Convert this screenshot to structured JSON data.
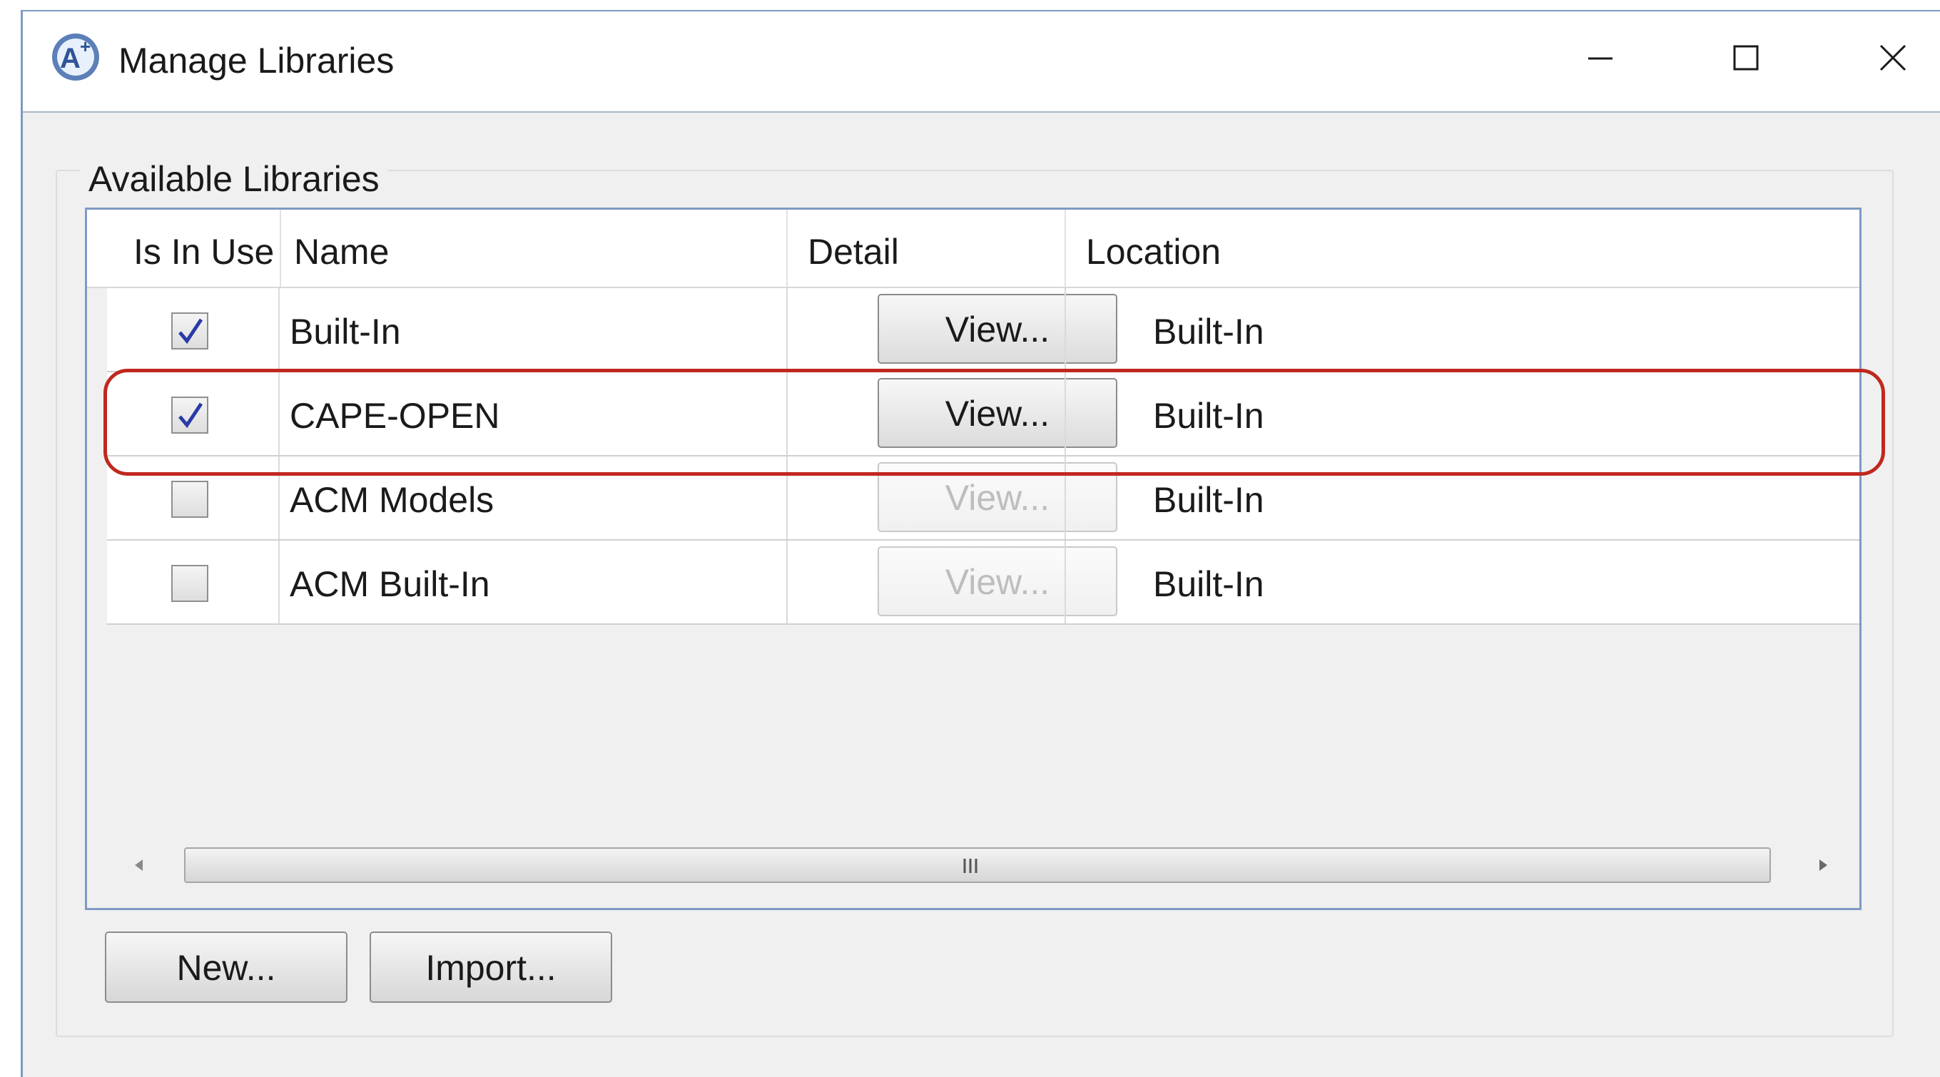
{
  "window": {
    "title": "Manage Libraries",
    "controls": {
      "minimize": "minimize-icon",
      "maximize": "maximize-icon",
      "close": "close-icon"
    }
  },
  "group": {
    "label": "Available Libraries"
  },
  "grid": {
    "columns": [
      "Is In Use",
      "Name",
      "Detail",
      "Location"
    ],
    "rows": [
      {
        "in_use": true,
        "name": "Built-In",
        "detail": "View...",
        "detail_enabled": true,
        "location": "Built-In"
      },
      {
        "in_use": true,
        "name": "CAPE-OPEN",
        "detail": "View...",
        "detail_enabled": true,
        "location": "Built-In"
      },
      {
        "in_use": false,
        "name": "ACM Models",
        "detail": "View...",
        "detail_enabled": false,
        "location": "Built-In"
      },
      {
        "in_use": false,
        "name": "ACM Built-In",
        "detail": "View...",
        "detail_enabled": false,
        "location": "Built-In"
      }
    ],
    "highlighted_row": "CAPE-OPEN"
  },
  "buttons": {
    "new": "New...",
    "import": "Import..."
  },
  "colors": {
    "highlight": "#c0281e",
    "border": "#7e9ac4",
    "check": "#2a3aa8"
  }
}
